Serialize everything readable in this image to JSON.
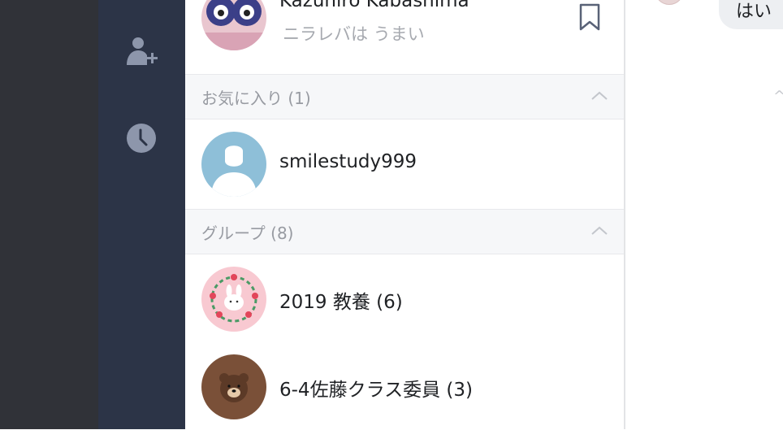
{
  "profile": {
    "name": "Kazuhiro Kabashima",
    "status": "ニラレバは うまい"
  },
  "favorites": {
    "title": "お気に入り (1)",
    "items": [
      {
        "name": "smilestudy999"
      }
    ]
  },
  "groups": {
    "title": "グループ (8)",
    "items": [
      {
        "name": "2019 教養  (6)"
      },
      {
        "name": "6-4佐藤クラス委員  (3)"
      }
    ]
  },
  "chat": {
    "bubble_text": "はい",
    "cut_char": "^"
  },
  "icons": {
    "rail": [
      "add-friend-icon",
      "clock-icon"
    ],
    "profile": "bookmark-icon",
    "sections": "chevron-up-icon"
  },
  "colors": {
    "rail_bg": "#2c3447",
    "rail_icon": "#8d96ab",
    "desktop_bg": "#303238",
    "section_bg": "#f6f7f9",
    "bubble_bg": "#edeff2"
  }
}
